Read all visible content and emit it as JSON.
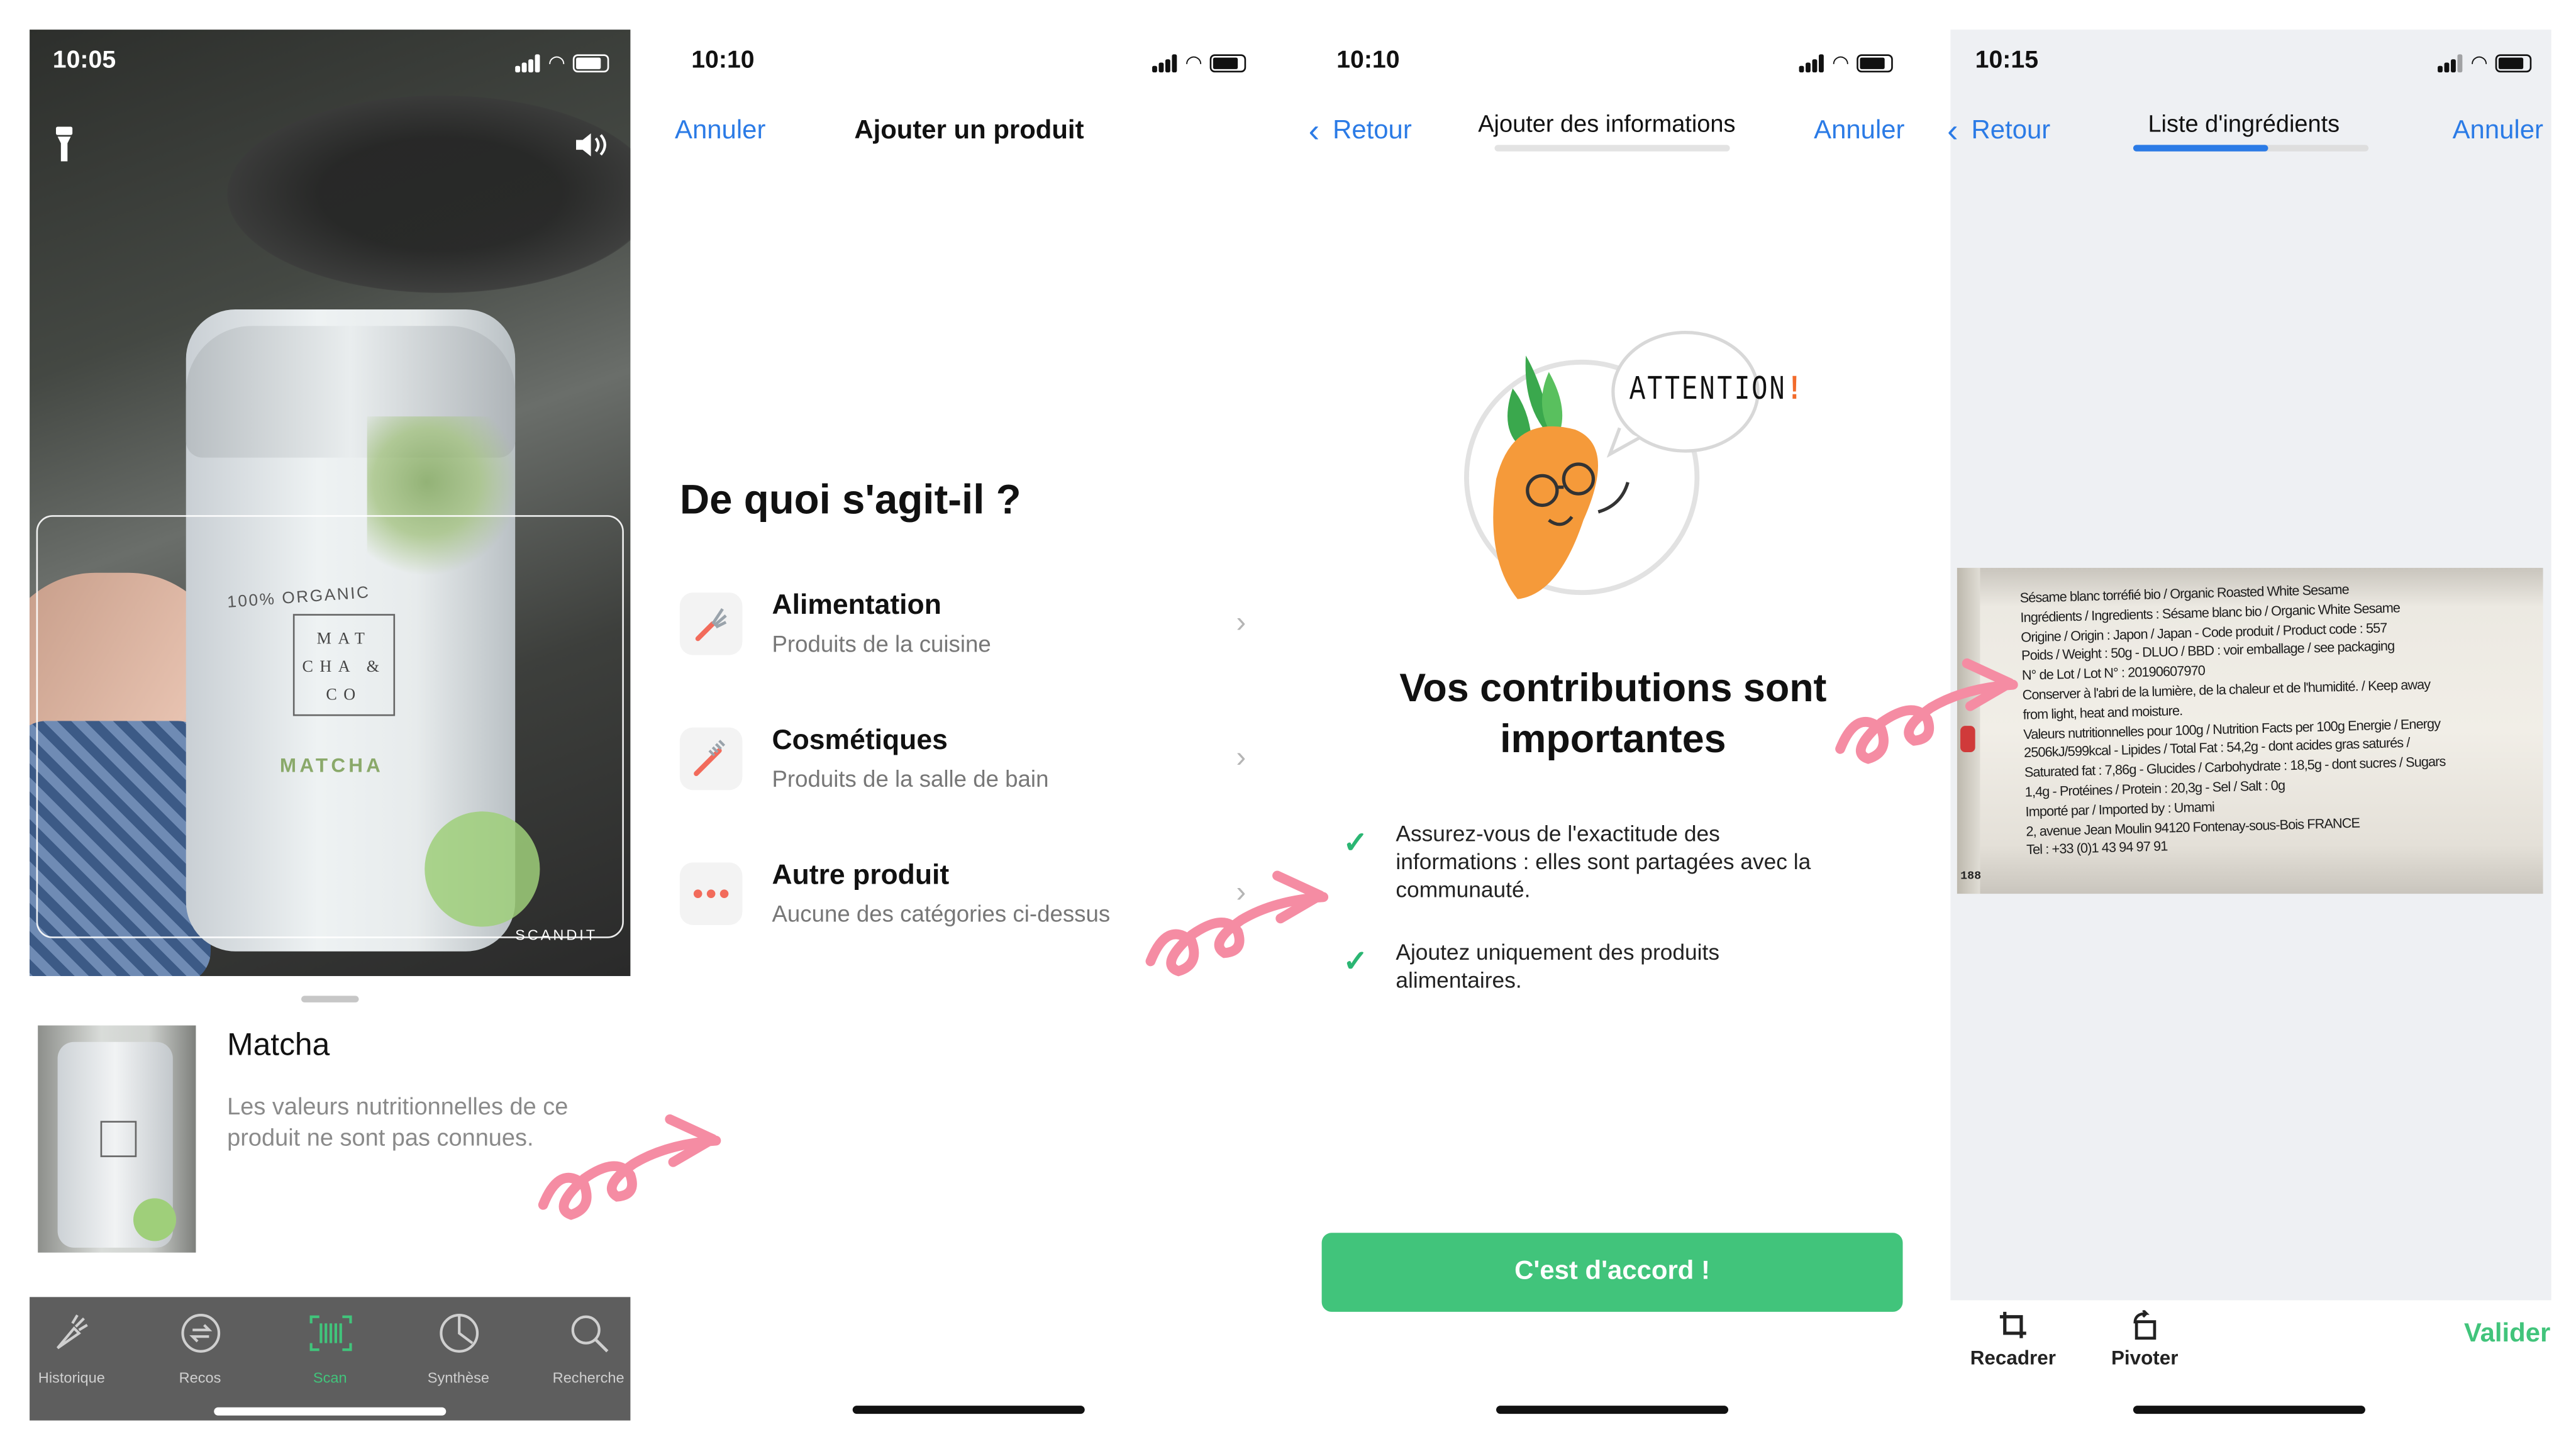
{
  "colors": {
    "accent_blue": "#2b7be6",
    "green": "#41c47b",
    "tab_active": "#41c47b",
    "pink_arrow": "#f58ca3"
  },
  "screen1": {
    "time": "10:05",
    "scanner_brand": "SCANDIT",
    "can_text": {
      "organic": "100% ORGANIC",
      "brand": "MAT CHA & CO",
      "product": "MATCHA"
    },
    "product": {
      "name": "Matcha",
      "description": "Les valeurs nutritionnelles de ce produit ne sont pas connues."
    },
    "tabs": [
      {
        "label": "Historique",
        "icon": "carrot-icon",
        "active": false
      },
      {
        "label": "Recos",
        "icon": "swap-icon",
        "active": false
      },
      {
        "label": "Scan",
        "icon": "barcode-icon",
        "active": true
      },
      {
        "label": "Synthèse",
        "icon": "pie-chart-icon",
        "active": false
      },
      {
        "label": "Recherche",
        "icon": "search-icon",
        "active": false
      }
    ]
  },
  "screen2": {
    "time": "10:10",
    "cancel": "Annuler",
    "title": "Ajouter un produit",
    "heading": "De quoi s'agit-il ?",
    "categories": [
      {
        "title": "Alimentation",
        "subtitle": "Produits de la cuisine",
        "icon": "fork-icon"
      },
      {
        "title": "Cosmétiques",
        "subtitle": "Produits de la salle de bain",
        "icon": "toothbrush-icon"
      },
      {
        "title": "Autre produit",
        "subtitle": "Aucune des catégories ci-dessus",
        "icon": "more-dots-icon"
      }
    ]
  },
  "screen3": {
    "time": "10:10",
    "back": "Retour",
    "title": "Ajouter des informations",
    "cancel": "Annuler",
    "progress": 0,
    "bubble": "ATTENTION",
    "bubble_mark": "!",
    "heading_line1": "Vos contributions sont",
    "heading_line2": "importantes",
    "checks": [
      {
        "line1": "Assurez-vous de l'exactitude des",
        "line2": "informations : elles sont partagées avec la",
        "line3": "communauté."
      },
      {
        "line1": "Ajoutez uniquement des produits",
        "line2": "alimentaires."
      }
    ],
    "button": "C'est d'accord !"
  },
  "screen4": {
    "time": "10:15",
    "back": "Retour",
    "title": "Liste d'ingrédients",
    "cancel": "Annuler",
    "progress": 0.57,
    "label_lines": [
      "Sésame blanc torréfié bio / Organic Roasted White Sesame",
      "Ingrédients / Ingredients : Sésame blanc bio / Organic White Sesame",
      "Origine / Origin : Japon / Japan - Code produit / Product code : 557",
      "Poids / Weight : 50g - DLUO / BBD : voir emballage / see packaging",
      "N° de Lot / Lot N° : 20190607970",
      "Conserver à l'abri de la lumière, de la chaleur et de l'humidité. / Keep away",
      "from light, heat and moisture.",
      "Valeurs nutritionnelles pour 100g / Nutrition Facts per 100g  Energie / Energy",
      "2506kJ/599kcal - Lipides / Total Fat : 54,2g - dont acides gras saturés /",
      "Saturated fat : 7,86g - Glucides / Carbohydrate : 18,5g - dont sucres / Sugars",
      "1,4g - Protéines / Protein : 20,3g - Sel / Salt : 0g",
      "Importé par / Imported by : Umami",
      "2, avenue Jean Moulin 94120 Fontenay-sous-Bois FRANCE",
      "Tel : +33 (0)1 43 94 97 91"
    ],
    "label_edge_num": "188",
    "tools": [
      {
        "label": "Recadrer",
        "icon": "crop-icon"
      },
      {
        "label": "Pivoter",
        "icon": "rotate-icon"
      }
    ],
    "validate": "Valider"
  }
}
